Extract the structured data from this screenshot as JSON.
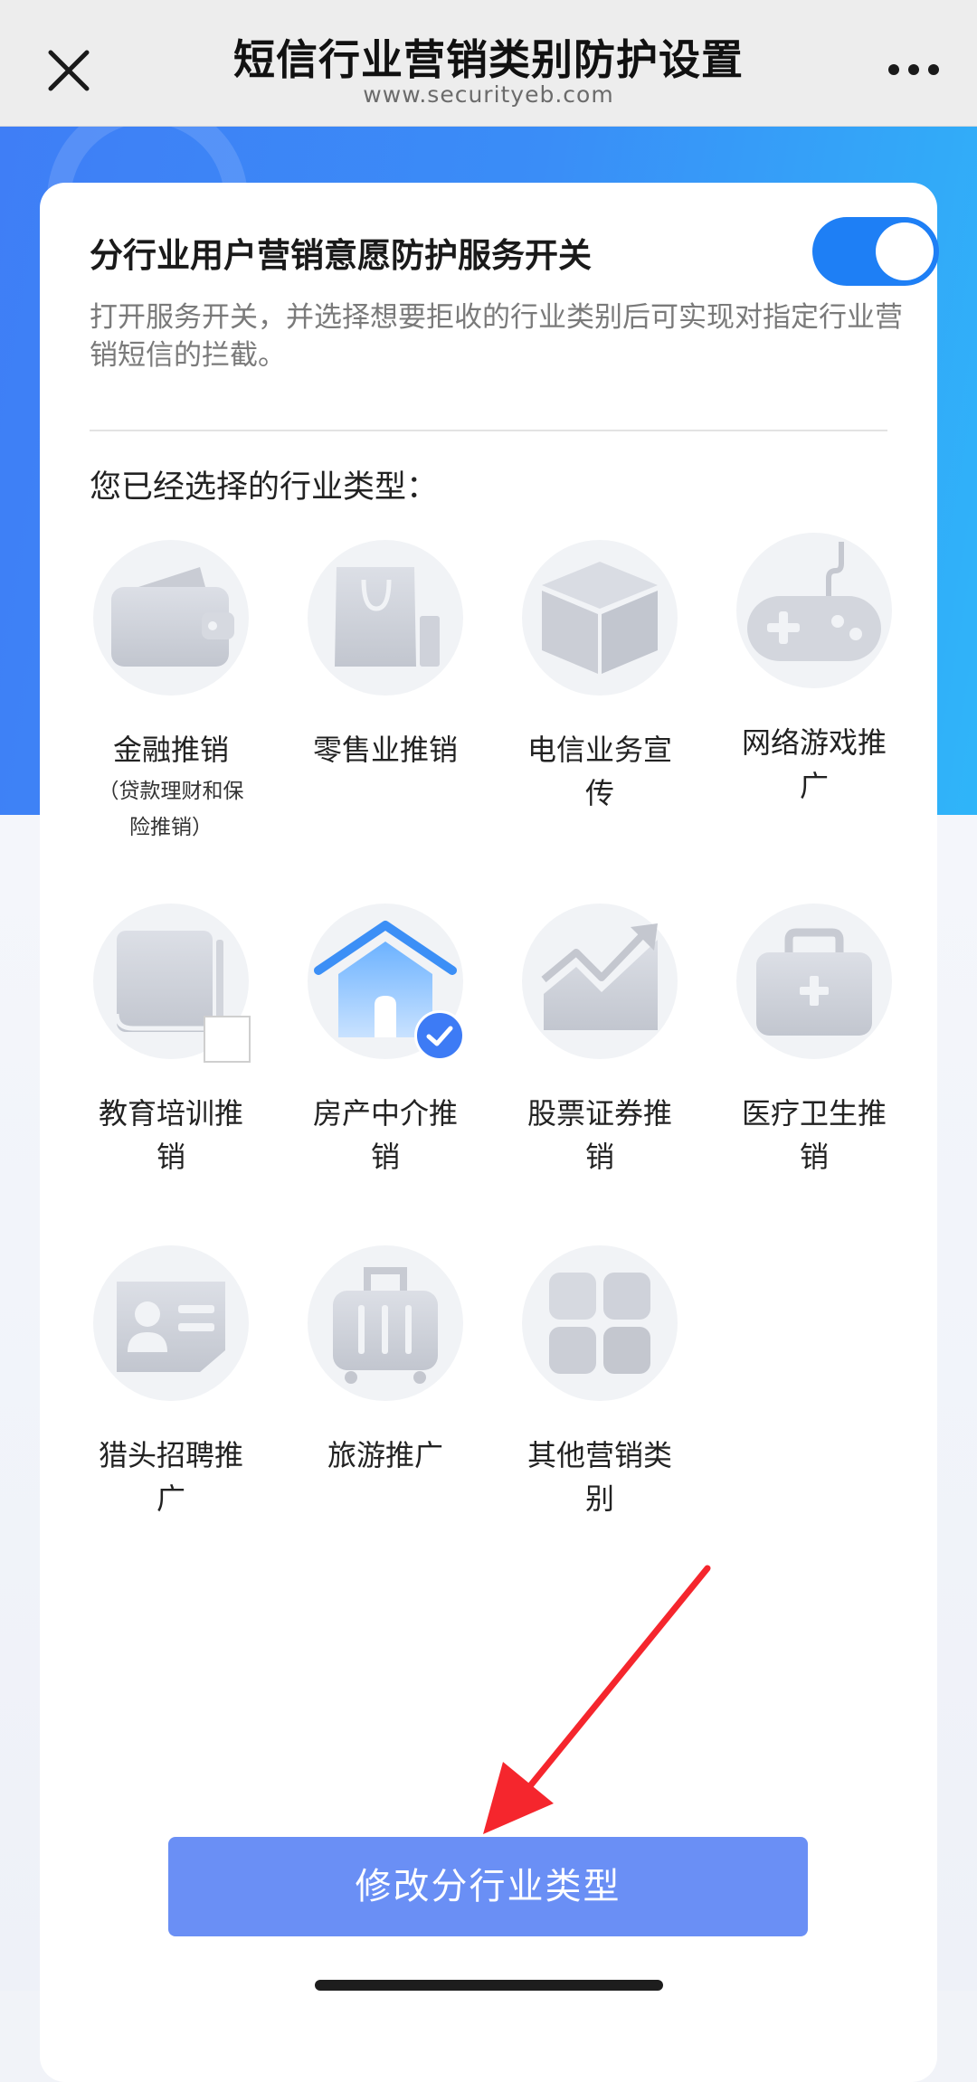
{
  "header": {
    "title": "短信行业营销类别防护设置",
    "subtitle": "www.securityeb.com",
    "close_icon": "close-icon",
    "more_icon": "more-horizontal-icon"
  },
  "service": {
    "toggle_label": "分行业用户营销意愿防护服务开关",
    "toggle_state": "on",
    "description": "打开服务开关，并选择想要拒收的行业类别后可实现对指定行业营销短信的拦截。"
  },
  "industries": {
    "section_title": "您已经选择的行业类型：",
    "items": [
      {
        "label": "金融推销",
        "sublabel": "（贷款理财和保险推销）",
        "icon": "wallet-icon",
        "selected": false
      },
      {
        "label": "零售业推销",
        "sublabel": "",
        "icon": "shopping-bag-icon",
        "selected": false
      },
      {
        "label": "电信业务宣传",
        "sublabel": "",
        "icon": "box-icon",
        "selected": false
      },
      {
        "label": "网络游戏推广",
        "sublabel": "",
        "icon": "gamepad-icon",
        "selected": false
      },
      {
        "label": "教育培训推销",
        "sublabel": "",
        "icon": "book-icon",
        "selected": false
      },
      {
        "label": "房产中介推销",
        "sublabel": "",
        "icon": "house-icon",
        "selected": true
      },
      {
        "label": "股票证券推销",
        "sublabel": "",
        "icon": "stock-chart-icon",
        "selected": false
      },
      {
        "label": "医疗卫生推销",
        "sublabel": "",
        "icon": "medical-kit-icon",
        "selected": false
      },
      {
        "label": "猎头招聘推广",
        "sublabel": "",
        "icon": "id-card-icon",
        "selected": false
      },
      {
        "label": "旅游推广",
        "sublabel": "",
        "icon": "suitcase-icon",
        "selected": false
      },
      {
        "label": "其他营销类别",
        "sublabel": "",
        "icon": "grid-icon",
        "selected": false
      }
    ]
  },
  "actions": {
    "modify_label": "修改分行业类型"
  },
  "colors": {
    "accent": "#1e7ff5",
    "button": "#6a8ff5",
    "hero_start": "#3f7ef6",
    "hero_end": "#2fb5f9",
    "annotation_arrow": "#f5262d"
  }
}
